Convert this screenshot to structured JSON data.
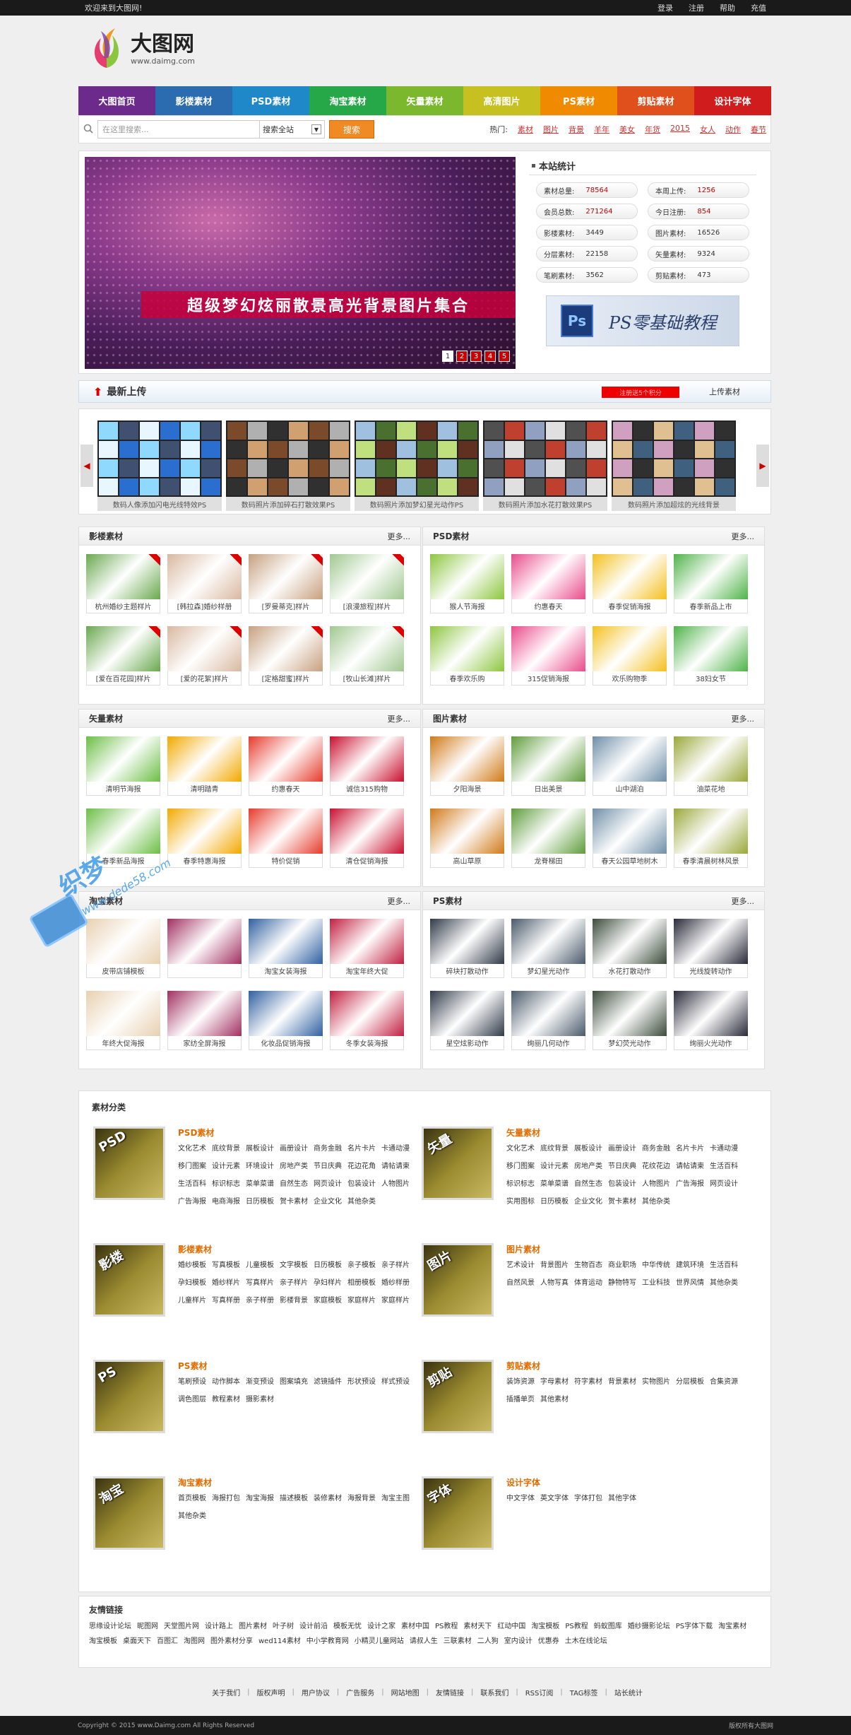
{
  "topbar": {
    "welcome": "欢迎来到大图网!",
    "links": [
      "登录",
      "注册",
      "帮助",
      "充值"
    ]
  },
  "logo": {
    "title": "大图网",
    "url": "www.daimg.com"
  },
  "nav": [
    {
      "label": "大图首页",
      "color": "#6b2a8c"
    },
    {
      "label": "影楼素材",
      "color": "#2b6cb0"
    },
    {
      "label": "PSD素材",
      "color": "#1e88c8"
    },
    {
      "label": "淘宝素材",
      "color": "#27a848"
    },
    {
      "label": "矢量素材",
      "color": "#7cb82e"
    },
    {
      "label": "高清图片",
      "color": "#c6c020"
    },
    {
      "label": "PS素材",
      "color": "#f08a00"
    },
    {
      "label": "剪贴素材",
      "color": "#e0501c"
    },
    {
      "label": "设计字体",
      "color": "#d01c1c"
    }
  ],
  "search": {
    "placeholder": "在这里搜索...",
    "scope": "搜索全站",
    "button": "搜索",
    "hot_label": "热门:",
    "hot": [
      "素材",
      "图片",
      "背景",
      "羊年",
      "美女",
      "年货",
      "2015",
      "女人",
      "动作",
      "春节"
    ]
  },
  "banner": {
    "caption": "超级梦幻炫丽散景高光背景图片集合",
    "pages": [
      "1",
      "2",
      "3",
      "4",
      "5"
    ]
  },
  "stats": {
    "title": "本站统计",
    "items": [
      {
        "label": "素材总量:",
        "value": "78564",
        "red": true
      },
      {
        "label": "本周上传:",
        "value": "1256",
        "red": true
      },
      {
        "label": "会员总数:",
        "value": "271264",
        "red": true
      },
      {
        "label": "今日注册:",
        "value": "854",
        "red": true
      },
      {
        "label": "影楼素材:",
        "value": "3449",
        "red": false
      },
      {
        "label": "图片素材:",
        "value": "16526",
        "red": false
      },
      {
        "label": "分层素材:",
        "value": "22158",
        "red": false
      },
      {
        "label": "矢量素材:",
        "value": "9324",
        "red": false
      },
      {
        "label": "笔刷素材:",
        "value": "3562",
        "red": false
      },
      {
        "label": "剪贴素材:",
        "value": "473",
        "red": false
      }
    ],
    "ad_logo": "Ps",
    "ad_text": "PS零基础教程"
  },
  "latest": {
    "title": "最新上传",
    "alert": "注册送5个积分",
    "upload": "上传素材",
    "items": [
      "数码人像添加闪电光线特效PS",
      "数码照片添加碎石打散效果PS",
      "数码照片添加梦幻星光动作PS",
      "数码照片添加水花打散效果PS",
      "数码照片添加超炫的光线背景"
    ]
  },
  "sections": [
    {
      "title": "影楼素材",
      "more": "更多...",
      "items": [
        "杭州婚纱主题样片",
        "[韩拉森]婚纱样册",
        "[罗曼蒂克]样片",
        "[浪漫旅程]样片",
        "[爱在百花园]样片",
        "[爱的花絮]样片",
        "[定格甜蜜]样片",
        "[牧山长滩]样片"
      ]
    },
    {
      "title": "PSD素材",
      "more": "更多...",
      "items": [
        "猴人节海报",
        "约惠春天",
        "春季促销海报",
        "春季新品上市",
        "春季欢乐购",
        "315促销海报",
        "欢乐购物季",
        "38妇女节"
      ]
    },
    {
      "title": "矢量素材",
      "more": "更多...",
      "items": [
        "清明节海报",
        "清明踏青",
        "约惠春天",
        "诚信315购物",
        "春季新品海报",
        "春季特惠海报",
        "特价促销",
        "清仓促销海报"
      ]
    },
    {
      "title": "图片素材",
      "more": "更多...",
      "items": [
        "夕阳海景",
        "日出美景",
        "山中湖泊",
        "油菜花地",
        "高山草原",
        "龙脊梯田",
        "春天公园草地树木",
        "春季清晨树林风景"
      ]
    },
    {
      "title": "淘宝素材",
      "more": "更多...",
      "items": [
        "皮带店铺模板",
        "",
        "淘宝女装海报",
        "淘宝年终大促",
        "年终大促海报",
        "家纺全屏海报",
        "化妆品促销海报",
        "冬季女装海报"
      ]
    },
    {
      "title": "PS素材",
      "more": "更多...",
      "items": [
        "碎块打散动作",
        "梦幻星光动作",
        "水花打散动作",
        "光线旋转动作",
        "星空炫影动作",
        "绚丽几何动作",
        "梦幻荧光动作",
        "绚丽火光动作"
      ]
    }
  ],
  "categories": {
    "title": "素材分类",
    "items": [
      {
        "name": "PSD素材",
        "img": "PSD",
        "tags": [
          "文化艺术",
          "底纹背景",
          "展板设计",
          "画册设计",
          "商务金融",
          "名片卡片",
          "卡通动漫",
          "移门图案",
          "设计元素",
          "环境设计",
          "房地产类",
          "节日庆典",
          "花边花角",
          "请帖请柬",
          "生活百科",
          "标识标志",
          "菜单菜谱",
          "自然生态",
          "网页设计",
          "包装设计",
          "人物图片",
          "广告海报",
          "电商海报",
          "日历模板",
          "贺卡素材",
          "企业文化",
          "其他杂类"
        ]
      },
      {
        "name": "矢量素材",
        "img": "矢量",
        "tags": [
          "文化艺术",
          "底纹背景",
          "展板设计",
          "画册设计",
          "商务金融",
          "名片卡片",
          "卡通动漫",
          "移门图案",
          "设计元素",
          "房地产类",
          "节日庆典",
          "花纹花边",
          "请帖请柬",
          "生活百科",
          "标识标志",
          "菜单菜谱",
          "自然生态",
          "包装设计",
          "人物图片",
          "广告海报",
          "网页设计",
          "实用图标",
          "日历模板",
          "企业文化",
          "贺卡素材",
          "其他杂类"
        ]
      },
      {
        "name": "影楼素材",
        "img": "影楼",
        "tags": [
          "婚纱模板",
          "写真模板",
          "儿童模板",
          "文字模板",
          "日历模板",
          "亲子模板",
          "亲子样片",
          "孕妇模板",
          "婚纱样片",
          "写真样片",
          "亲子样片",
          "孕妇样片",
          "相册模板",
          "婚纱样册",
          "儿童样片",
          "写真样册",
          "亲子样册",
          "影楼背景",
          "家庭模板",
          "家庭样片",
          "家庭样片"
        ]
      },
      {
        "name": "图片素材",
        "img": "图片",
        "tags": [
          "艺术设计",
          "背景图片",
          "生物百态",
          "商业职场",
          "中华传统",
          "建筑环境",
          "生活百科",
          "自然风景",
          "人物写真",
          "体育运动",
          "静物特写",
          "工业科技",
          "世界风情",
          "其他杂类"
        ]
      },
      {
        "name": "PS素材",
        "img": "PS",
        "tags": [
          "笔刷预设",
          "动作脚本",
          "渐变预设",
          "图案填充",
          "滤镜插件",
          "形状预设",
          "样式预设",
          "调色图层",
          "教程素材",
          "摄影素材"
        ]
      },
      {
        "name": "剪贴素材",
        "img": "剪贴",
        "tags": [
          "装饰资源",
          "字母素材",
          "符字素材",
          "背景素材",
          "实物图片",
          "分层模板",
          "合集资源",
          "插播单页",
          "其他素材"
        ]
      },
      {
        "name": "淘宝素材",
        "img": "淘宝",
        "tags": [
          "首页模板",
          "海报打包",
          "淘宝海报",
          "描述模板",
          "装修素材",
          "海报背景",
          "淘宝主图",
          "其他杂类"
        ]
      },
      {
        "name": "设计字体",
        "img": "字体",
        "tags": [
          "中文字体",
          "英文字体",
          "字体打包",
          "其他字体"
        ]
      }
    ]
  },
  "friends": {
    "title": "友情链接",
    "links": [
      "思缘设计论坛",
      "昵图网",
      "天堂图片网",
      "设计路上",
      "图片素材",
      "叶子树",
      "设计前沿",
      "模板无忧",
      "设计之家",
      "素材中国",
      "PS教程",
      "素材天下",
      "红动中国",
      "淘宝模板",
      "PS教程",
      "蚂蚁图库",
      "婚纱摄影论坛",
      "PS字体下载",
      "淘宝素材",
      "淘宝模板",
      "桌面天下",
      "百图汇",
      "淘图网",
      "图外素材分享",
      "wed114素材",
      "中小学教育网",
      "小精灵儿童网站",
      "请叔人生",
      "三联素材",
      "二人狗",
      "室内设计",
      "优惠券",
      "土木在线论坛"
    ]
  },
  "footnav": [
    "关于我们",
    "版权声明",
    "用户协议",
    "广告服务",
    "网站地图",
    "友情链接",
    "联系我们",
    "RSS订阅",
    "TAG标签",
    "站长统计"
  ],
  "footer": {
    "left": "Copyright © 2015 www.Daimg.com All Rights Reserved",
    "right": "版权所有大图网"
  },
  "watermark": {
    "text": "织梦",
    "url": "www.dede58.com"
  }
}
